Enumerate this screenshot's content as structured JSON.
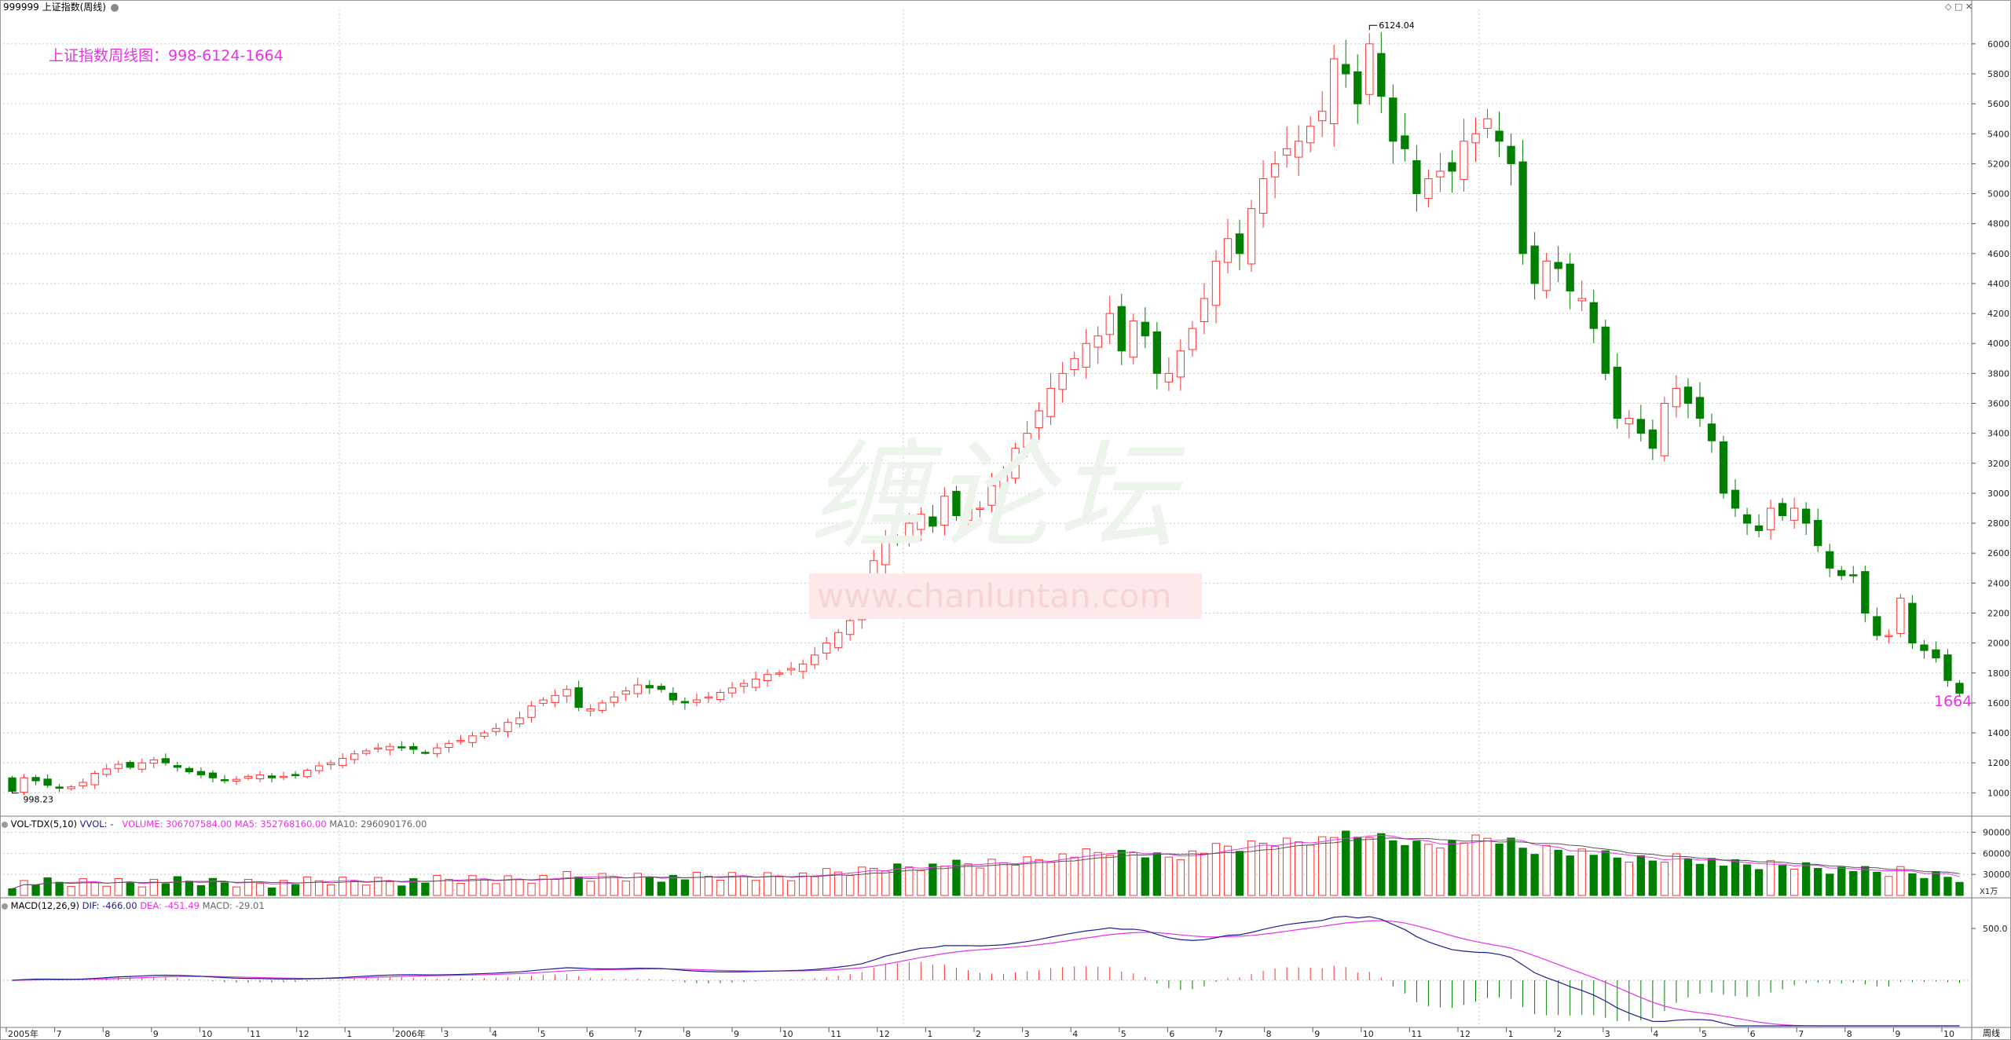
{
  "window": {
    "title": "999999 上证指数(周线)",
    "chart_title": "上证指数周线图：998-6124-1664"
  },
  "vol_panel": {
    "name": "VOL-TDX(5,10)",
    "vvol_label": "VVOL: -",
    "volume_label": "VOLUME: 306707584.00",
    "ma5_label": "MA5: 352768160.00",
    "ma10_label": "MA10: 296090176.00",
    "axis_ticks": [
      "90000",
      "60000",
      "30000"
    ],
    "unit": "X1万"
  },
  "macd_panel": {
    "name": "MACD(12,26,9)",
    "dif_label": "DIF: -466.00",
    "dea_label": "DEA: -451.49",
    "macd_label": "MACD: -29.01",
    "axis_ticks": [
      "500.0"
    ]
  },
  "annotations": {
    "high_label": "6124.04",
    "low_label": "998.23",
    "last_label": "1664"
  },
  "period_label": "周线",
  "time_axis": [
    "2005年",
    "7",
    "8",
    "9",
    "10",
    "11",
    "12",
    "1",
    "2006年",
    "3",
    "4",
    "5",
    "6",
    "7",
    "8",
    "9",
    "10",
    "11",
    "12",
    "1",
    "2",
    "3",
    "4",
    "5",
    "6",
    "7",
    "8",
    "9",
    "10",
    "11",
    "12",
    "1",
    "2",
    "3",
    "4",
    "5",
    "6",
    "7",
    "8",
    "9",
    "10"
  ],
  "watermark": {
    "logo": "缠论坛",
    "url": "www.chanluntan.com"
  },
  "colors": {
    "up": "#ff3232",
    "down": "#007f00",
    "title": "#e633e6",
    "ma5": "#e633e6",
    "ma10": "#555555",
    "dif": "#1e1e8c",
    "dea": "#e633e6",
    "grid": "#c8c8c8"
  },
  "chart_data": {
    "type": "candlestick",
    "title": "上证指数周线图：998-6124-1664",
    "y_ticks": [
      1000,
      1200,
      1400,
      1600,
      1800,
      2000,
      2200,
      2400,
      2600,
      2800,
      3000,
      3200,
      3400,
      3600,
      3800,
      4000,
      4200,
      4400,
      4600,
      4800,
      5000,
      5200,
      5400,
      5600,
      5800,
      6000
    ],
    "ylim": [
      860,
      6230
    ],
    "weekly_close": [
      1010,
      1100,
      1080,
      1050,
      1030,
      1040,
      1070,
      1130,
      1160,
      1190,
      1170,
      1200,
      1220,
      1200,
      1170,
      1140,
      1120,
      1100,
      1080,
      1090,
      1110,
      1120,
      1100,
      1110,
      1120,
      1150,
      1180,
      1200,
      1230,
      1260,
      1280,
      1300,
      1310,
      1300,
      1290,
      1270,
      1300,
      1330,
      1350,
      1380,
      1400,
      1430,
      1470,
      1500,
      1580,
      1620,
      1650,
      1690,
      1570,
      1560,
      1600,
      1640,
      1680,
      1720,
      1700,
      1690,
      1620,
      1600,
      1620,
      1640,
      1670,
      1700,
      1730,
      1760,
      1790,
      1800,
      1830,
      1860,
      1920,
      2000,
      2070,
      2150,
      2250,
      2550,
      2700,
      2680,
      2800,
      2860,
      2780,
      2980,
      2850,
      2900,
      2900,
      3050,
      3120,
      3300,
      3400,
      3550,
      3700,
      3800,
      3900,
      4000,
      4050,
      4200,
      3950,
      4150,
      4050,
      3800,
      3800,
      3950,
      4100,
      4300,
      4550,
      4700,
      4600,
      4900,
      5100,
      5200,
      5300,
      5350,
      5450,
      5550,
      5900,
      5800,
      5600,
      6000,
      5650,
      5350,
      5300,
      5000,
      5100,
      5150,
      5150,
      5350,
      5400,
      5500,
      5350,
      5200,
      4600,
      4400,
      4550,
      4500,
      4350,
      4300,
      4100,
      3800,
      3500,
      3500,
      3400,
      3300,
      3600,
      3700,
      3600,
      3500,
      3350,
      3000,
      2900,
      2800,
      2750,
      2900,
      2850,
      2900,
      2800,
      2650,
      2500,
      2450,
      2450,
      2200,
      2050,
      2050,
      2300,
      2000,
      1950,
      1900,
      1750,
      1664
    ],
    "high": 6124.04,
    "low": 998.23,
    "last": 1664,
    "volume_axis": [
      30000,
      60000,
      90000
    ],
    "macd_axis": [
      500.0
    ],
    "dif": -466.0,
    "dea": -451.49,
    "macd": -29.01
  }
}
